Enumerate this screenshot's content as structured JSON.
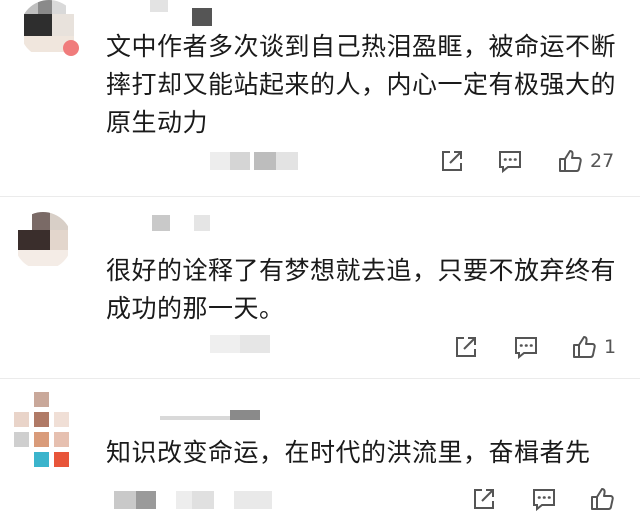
{
  "comments": [
    {
      "text": "文中作者多次谈到自己热泪盈眶，被命运不断\n摔打却又能站起来的人，内心一定有极强大的\n原生动力",
      "likes": "27"
    },
    {
      "text": "很好的诠释了有梦想就去追，只要不放弃终有\n成功的那一天。",
      "likes": "1"
    },
    {
      "text": "知识改变命运，在时代的洪流里，奋楫者先",
      "likes": ""
    }
  ],
  "icons": {
    "share": "share-icon",
    "comment": "comment-icon",
    "like": "thumbs-up-icon"
  },
  "colors": {
    "text": "#1a1a1a",
    "icon": "#555555",
    "count": "#555555"
  }
}
